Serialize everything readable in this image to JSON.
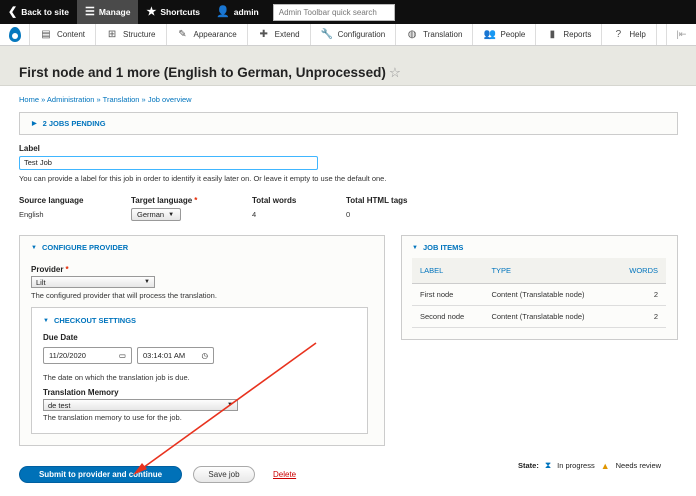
{
  "topbar": {
    "back_label": "Back to site",
    "manage_label": "Manage",
    "shortcuts_label": "Shortcuts",
    "user_label": "admin",
    "search_placeholder": "Admin Toolbar quick search"
  },
  "toolbar": {
    "items": [
      {
        "label": "Content",
        "icon": "document-icon"
      },
      {
        "label": "Structure",
        "icon": "structure-icon"
      },
      {
        "label": "Appearance",
        "icon": "brush-icon"
      },
      {
        "label": "Extend",
        "icon": "puzzle-icon"
      },
      {
        "label": "Configuration",
        "icon": "wrench-icon"
      },
      {
        "label": "Translation",
        "icon": "globe-icon"
      },
      {
        "label": "People",
        "icon": "people-icon"
      },
      {
        "label": "Reports",
        "icon": "bar-chart-icon"
      },
      {
        "label": "Help",
        "icon": "help-icon"
      }
    ]
  },
  "page": {
    "title": "First node and 1 more (English to German, Unprocessed)",
    "breadcrumb": "Home » Administration » Translation » Job overview",
    "jobs_pending": "2 JOBS PENDING"
  },
  "form": {
    "label_heading": "Label",
    "label_value": "Test Job",
    "label_help": "You can provide a label for this job in order to identify it easily later on. Or leave it empty to use the default one.",
    "source_language_label": "Source language",
    "source_language_value": "English",
    "target_language_label": "Target language",
    "target_language_value": "German",
    "total_words_label": "Total words",
    "total_words_value": "4",
    "total_html_label": "Total HTML tags",
    "total_html_value": "0"
  },
  "provider": {
    "section_title": "CONFIGURE PROVIDER",
    "provider_label": "Provider",
    "provider_value": "Lilt",
    "provider_help": "The configured provider that will process the translation.",
    "checkout_title": "CHECKOUT SETTINGS",
    "due_date_label": "Due Date",
    "date_value": "11/20/2020",
    "time_value": "03:14:01 AM",
    "due_date_help": "The date on which the translation job is due.",
    "tm_label": "Translation Memory",
    "tm_value": "de test",
    "tm_help": "The translation memory to use for the job."
  },
  "job_items": {
    "title": "JOB ITEMS",
    "headers": [
      "LABEL",
      "TYPE",
      "WORDS"
    ],
    "rows": [
      [
        "First node",
        "Content (Translatable node)",
        "2"
      ],
      [
        "Second node",
        "Content (Translatable node)",
        "2"
      ]
    ]
  },
  "actions": {
    "submit_label": "Submit to provider and continue",
    "save_label": "Save job",
    "delete_label": "Delete"
  },
  "state": {
    "label": "State:",
    "in_progress": "In progress",
    "needs_review": "Needs review"
  },
  "colors": {
    "accent": "#0074bd",
    "primary_button": "#0071b8",
    "annotation_arrow": "#e8321e"
  }
}
